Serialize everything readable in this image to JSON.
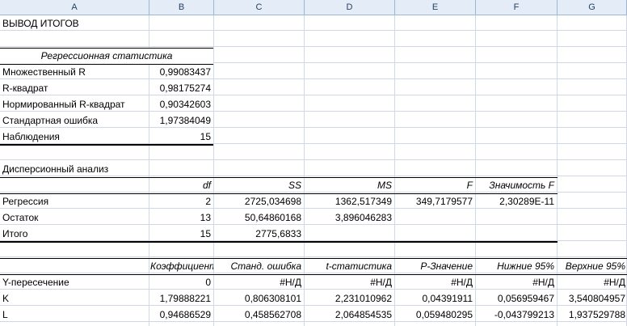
{
  "columns": [
    "A",
    "B",
    "C",
    "D",
    "E",
    "F",
    "G"
  ],
  "title": "ВЫВОД ИТОГОВ",
  "regression_statistics": {
    "header": "Регрессионная статистика",
    "rows": [
      {
        "label": "Множественный R",
        "value": "0,99083437"
      },
      {
        "label": "R-квадрат",
        "value": "0,98175274"
      },
      {
        "label": "Нормированный R-квадрат",
        "value": "0,90342603"
      },
      {
        "label": "Стандартная ошибка",
        "value": "1,97384049"
      },
      {
        "label": "Наблюдения",
        "value": "15"
      }
    ]
  },
  "anova": {
    "title": "Дисперсионный анализ",
    "headers": [
      "df",
      "SS",
      "MS",
      "F",
      "Значимость F"
    ],
    "rows": [
      {
        "label": "Регрессия",
        "df": "2",
        "ss": "2725,034698",
        "ms": "1362,517349",
        "f": "349,7179577",
        "sig": "2,30289E-11"
      },
      {
        "label": "Остаток",
        "df": "13",
        "ss": "50,64860168",
        "ms": "3,896046283",
        "f": "",
        "sig": ""
      },
      {
        "label": "Итого",
        "df": "15",
        "ss": "2775,6833",
        "ms": "",
        "f": "",
        "sig": ""
      }
    ]
  },
  "coefficients": {
    "headers": [
      "Коэффициенты",
      "Станд. ошибка",
      "t-статистика",
      "P-Значение",
      "Нижние 95%",
      "Верхние 95%"
    ],
    "rows": [
      {
        "label": "Y-пересечение",
        "values": [
          "0",
          "#Н/Д",
          "#Н/Д",
          "#Н/Д",
          "#Н/Д",
          "#Н/Д"
        ]
      },
      {
        "label": "K",
        "values": [
          "1,79888221",
          "0,806308101",
          "2,231010962",
          "0,04391911",
          "0,056959467",
          "3,540804957"
        ]
      },
      {
        "label": "L",
        "values": [
          "0,94686529",
          "0,458562708",
          "2,064854535",
          "0,059480295",
          "-0,043799213",
          "1,937529788"
        ]
      }
    ]
  }
}
